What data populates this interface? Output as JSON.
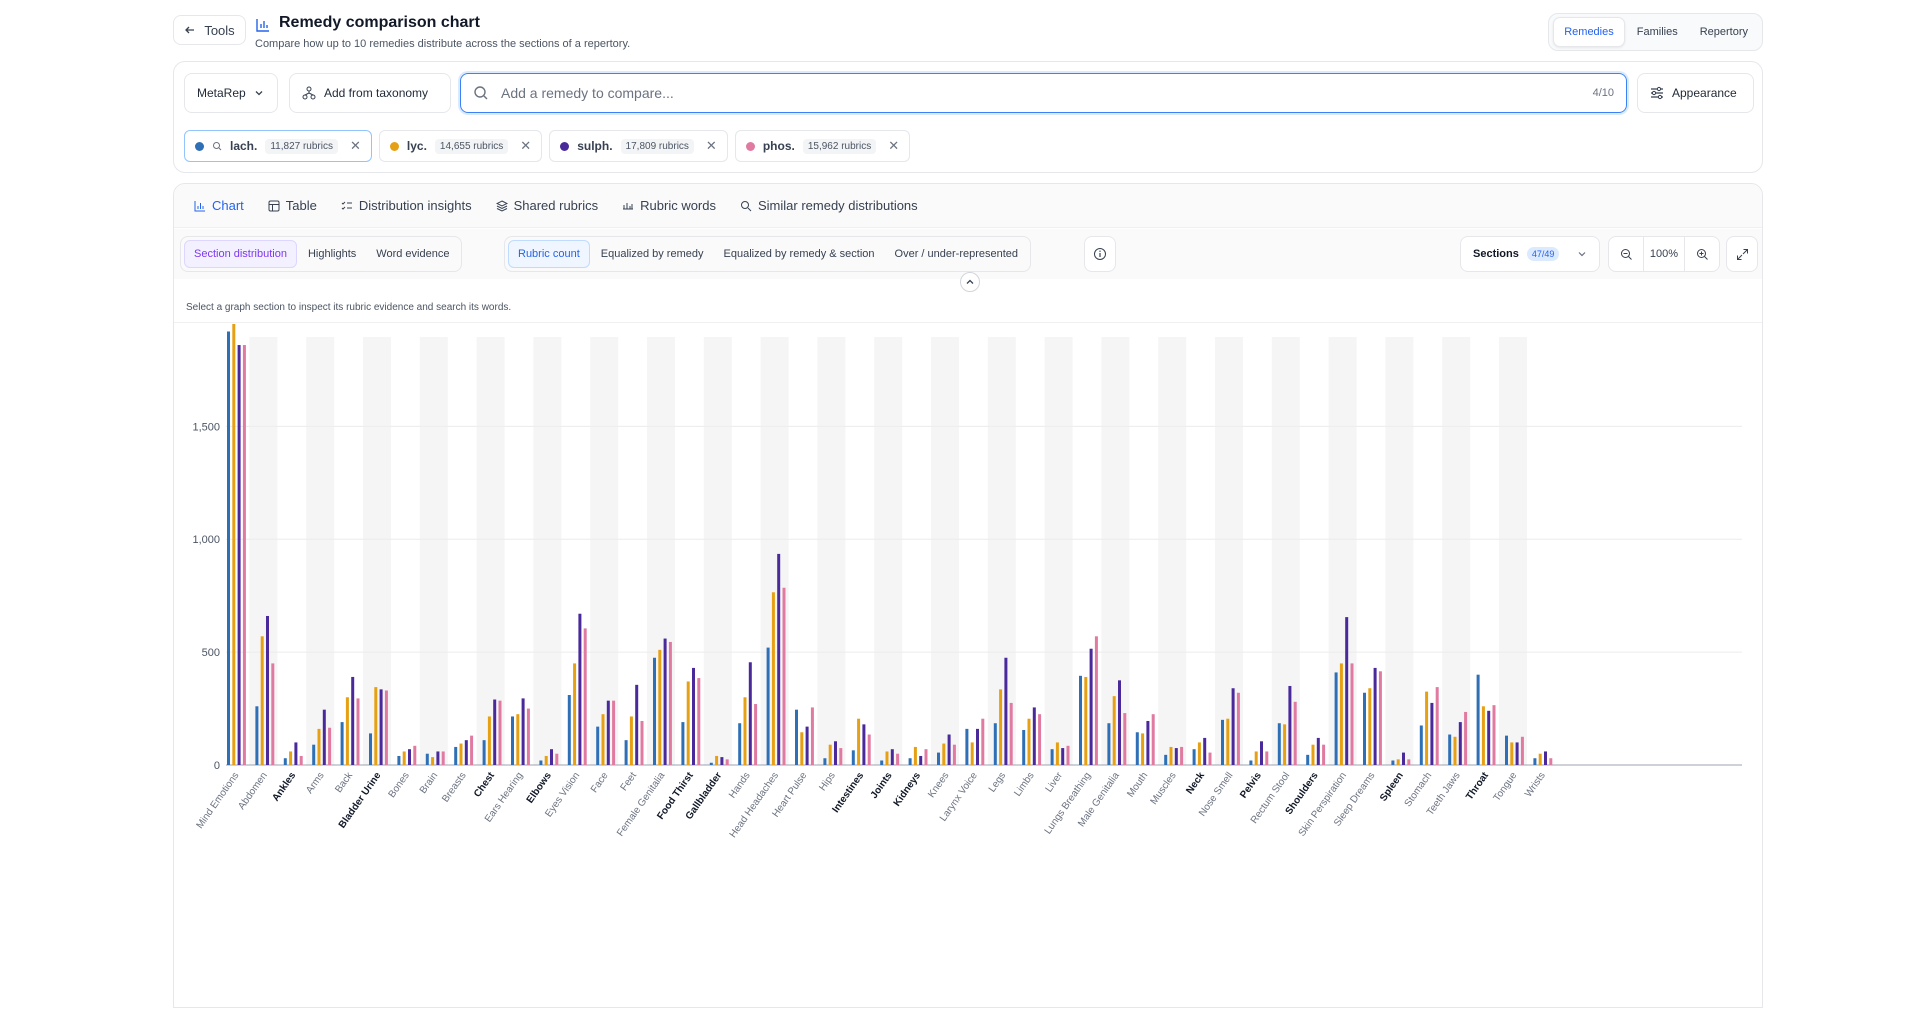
{
  "header": {
    "tools_label": "Tools",
    "title": "Remedy comparison chart",
    "subtitle": "Compare how up to 10 remedies distribute across the sections of a repertory.",
    "view_tabs": [
      {
        "label": "Remedies",
        "active": true
      },
      {
        "label": "Families",
        "active": false
      },
      {
        "label": "Repertory",
        "active": false
      }
    ]
  },
  "controls": {
    "repertory_label": "MetaRep",
    "add_taxonomy_label": "Add from taxonomy",
    "search_placeholder": "Add a remedy to compare...",
    "search_count": "4/10",
    "appearance_label": "Appearance"
  },
  "remedies": [
    {
      "name": "lach.",
      "rubrics": "11,827 rubrics",
      "color": "#2f6fb5"
    },
    {
      "name": "lyc.",
      "rubrics": "14,655 rubrics",
      "color": "#e6a013"
    },
    {
      "name": "sulph.",
      "rubrics": "17,809 rubrics",
      "color": "#4a2a9b"
    },
    {
      "name": "phos.",
      "rubrics": "15,962 rubrics",
      "color": "#e07aa0"
    }
  ],
  "tabs": [
    {
      "label": "Chart",
      "icon": "bar-chart-icon",
      "active": true
    },
    {
      "label": "Table",
      "icon": "table-icon",
      "active": false
    },
    {
      "label": "Distribution insights",
      "icon": "list-check-icon",
      "active": false
    },
    {
      "label": "Shared rubrics",
      "icon": "layers-icon",
      "active": false
    },
    {
      "label": "Rubric words",
      "icon": "words-icon",
      "active": false
    },
    {
      "label": "Similar remedy distributions",
      "icon": "search-icon",
      "active": false
    }
  ],
  "view_modes": [
    {
      "label": "Section distribution",
      "active": true
    },
    {
      "label": "Highlights",
      "active": false
    },
    {
      "label": "Word evidence",
      "active": false
    }
  ],
  "measures": [
    {
      "label": "Rubric count",
      "active": true
    },
    {
      "label": "Equalized by remedy",
      "active": false
    },
    {
      "label": "Equalized by remedy & section",
      "active": false
    },
    {
      "label": "Over / under-represented",
      "active": false
    }
  ],
  "sections_label": "Sections",
  "sections_count": "47/49",
  "zoom": "100%",
  "hint": "Select a graph section to inspect its rubric evidence and search its words.",
  "chart_data": {
    "type": "bar",
    "ylim": [
      0,
      2000
    ],
    "yticks": [
      0,
      500,
      1000,
      1500
    ],
    "ytick_labels": [
      "0",
      "500",
      "1,000",
      "1,500"
    ],
    "grid": true,
    "categories": [
      "Mind Emotions",
      "Abdomen",
      "Ankles",
      "Arms",
      "Back",
      "Bladder Urine",
      "Bones",
      "Brain",
      "Breasts",
      "Chest",
      "Ears Hearing",
      "Elbows",
      "Eyes Vision",
      "Face",
      "Feet",
      "Female Genitalia",
      "Food Thirst",
      "Gallbladder",
      "Hands",
      "Head Headaches",
      "Heart Pulse",
      "Hips",
      "Intestines",
      "Joints",
      "Kidneys",
      "Knees",
      "Larynx Voice",
      "Legs",
      "Limbs",
      "Liver",
      "Lungs Breathing",
      "Male Genitalia",
      "Mouth",
      "Muscles",
      "Neck",
      "Nose Smell",
      "Pelvis",
      "Rectum Stool",
      "Shoulders",
      "Skin Perspiration",
      "Sleep Dreams",
      "Spleen",
      "Stomach",
      "Teeth Jaws",
      "Throat",
      "Tongue",
      "Wrists"
    ],
    "bold_categories": [
      "Ankles",
      "Bladder Urine",
      "Chest",
      "Elbows",
      "Food Thirst",
      "Gallbladder",
      "Intestines",
      "Joints",
      "Kidneys",
      "Neck",
      "Pelvis",
      "Shoulders",
      "Spleen",
      "Throat"
    ],
    "series": [
      {
        "name": "lach.",
        "values": [
          1920,
          260,
          30,
          90,
          190,
          140,
          40,
          50,
          80,
          110,
          215,
          20,
          310,
          170,
          110,
          475,
          190,
          10,
          185,
          520,
          245,
          30,
          65,
          20,
          30,
          55,
          160,
          185,
          155,
          70,
          395,
          185,
          145,
          45,
          70,
          200,
          20,
          185,
          45,
          410,
          320,
          20,
          175,
          135,
          400,
          130,
          30
        ]
      },
      {
        "name": "lyc.",
        "values": [
          1990,
          570,
          60,
          160,
          300,
          345,
          60,
          35,
          95,
          215,
          225,
          40,
          450,
          225,
          215,
          510,
          370,
          40,
          300,
          765,
          145,
          90,
          205,
          60,
          80,
          95,
          100,
          335,
          205,
          100,
          390,
          305,
          140,
          80,
          100,
          205,
          60,
          180,
          90,
          450,
          340,
          25,
          325,
          125,
          260,
          100,
          50
        ]
      },
      {
        "name": "sulph.",
        "values": [
          1860,
          660,
          100,
          245,
          390,
          335,
          70,
          60,
          110,
          290,
          295,
          70,
          670,
          285,
          355,
          560,
          430,
          35,
          455,
          935,
          170,
          105,
          180,
          70,
          40,
          135,
          160,
          475,
          255,
          75,
          515,
          375,
          195,
          75,
          120,
          340,
          105,
          350,
          120,
          655,
          430,
          55,
          275,
          190,
          240,
          100,
          60
        ]
      },
      {
        "name": "phos.",
        "values": [
          1860,
          450,
          40,
          165,
          295,
          330,
          85,
          60,
          130,
          285,
          250,
          50,
          605,
          285,
          195,
          545,
          385,
          25,
          270,
          785,
          255,
          75,
          135,
          50,
          70,
          90,
          205,
          275,
          225,
          85,
          570,
          230,
          225,
          80,
          55,
          320,
          60,
          280,
          90,
          450,
          415,
          25,
          345,
          235,
          265,
          125,
          30
        ]
      }
    ]
  }
}
